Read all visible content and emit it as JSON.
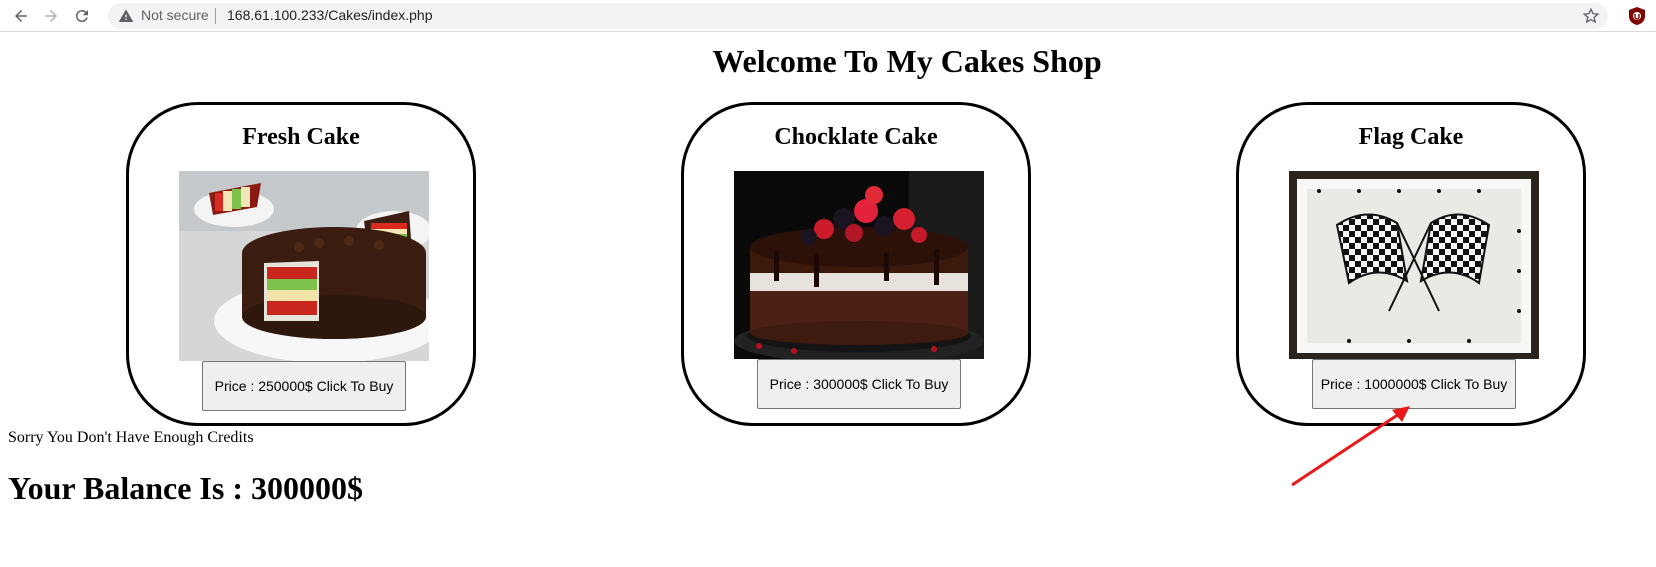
{
  "browser": {
    "security_label": "Not secure",
    "url": "168.61.100.233/Cakes/index.php",
    "icons": [
      "back-arrow-icon",
      "forward-arrow-icon",
      "reload-icon",
      "warning-triangle-icon",
      "star-icon",
      "ublock-icon"
    ]
  },
  "page": {
    "title": "Welcome To My Cakes Shop",
    "cards": [
      {
        "name": "Fresh Cake",
        "button": "Price : 250000$ Click To Buy"
      },
      {
        "name": "Chocklate Cake",
        "button": "Price : 300000$ Click To Buy"
      },
      {
        "name": "Flag Cake",
        "button": "Price : 1000000$ Click To Buy"
      }
    ],
    "message": "Sorry You Don't Have Enough Credits",
    "balance": "Your Balance Is : 300000$"
  },
  "colors": {
    "annotation_arrow": "#e8191a",
    "ublock_badge": "#800000"
  }
}
